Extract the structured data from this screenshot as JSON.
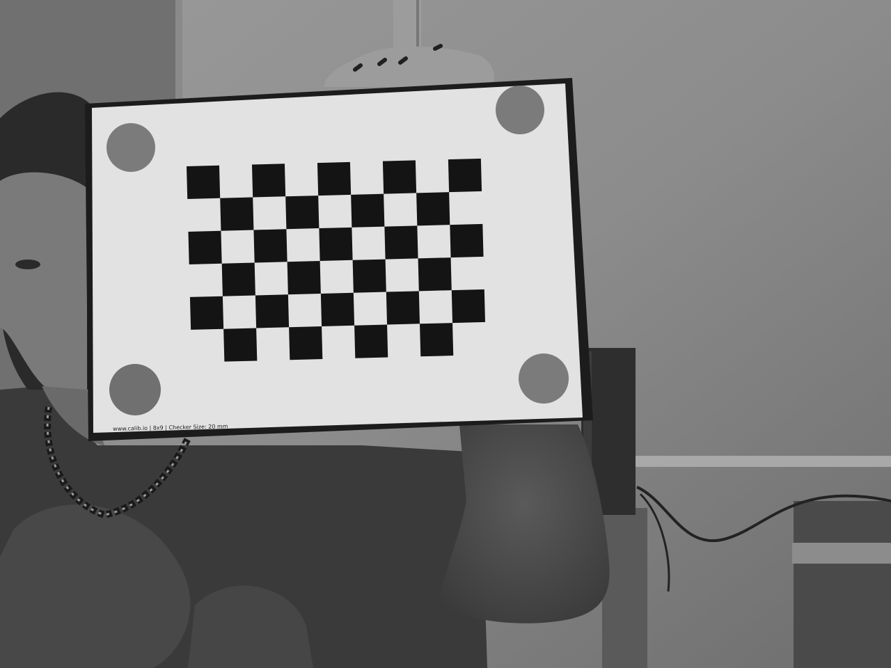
{
  "board": {
    "caption": "www.calib.io | 8x9 | Checker Size: 20 mm",
    "rows": 6,
    "cols": 9
  }
}
